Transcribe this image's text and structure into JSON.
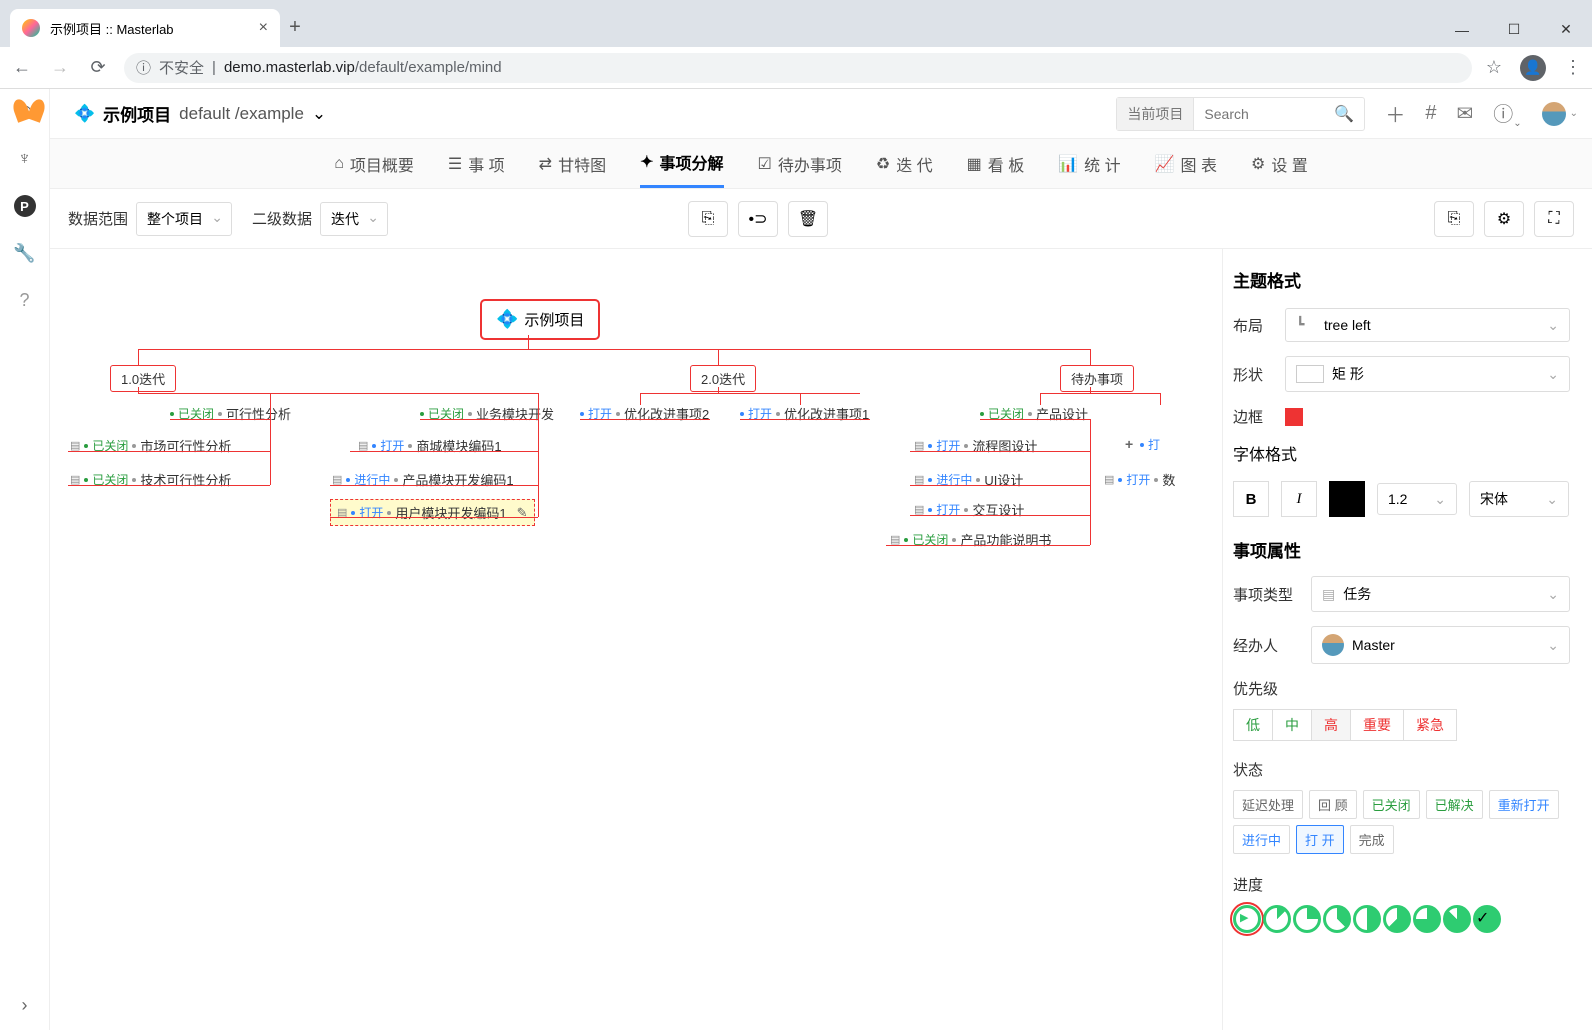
{
  "browser": {
    "tab_title": "示例项目 :: Masterlab",
    "url_insecure": "不安全",
    "url_host": "demo.masterlab.vip",
    "url_path": "/default/example/mind"
  },
  "header": {
    "project_name": "示例项目",
    "project_path": "default /example",
    "search_label": "当前项目",
    "search_placeholder": "Search"
  },
  "nav": {
    "overview": "项目概要",
    "issues": "事 项",
    "gantt": "甘特图",
    "breakdown": "事项分解",
    "backlog": "待办事项",
    "iteration": "迭 代",
    "kanban": "看 板",
    "stats": "统 计",
    "charts": "图 表",
    "settings": "设 置"
  },
  "toolbar": {
    "scope_label": "数据范围",
    "scope_value": "整个项目",
    "level2_label": "二级数据",
    "level2_value": "迭代"
  },
  "mind": {
    "root": "示例项目",
    "branch1": "1.0迭代",
    "branch2": "2.0迭代",
    "branch3": "待办事项",
    "status": {
      "closed": "已关闭",
      "open": "打开",
      "in_progress": "进行中"
    },
    "nodes": {
      "n1": "可行性分析",
      "n1a": "市场可行性分析",
      "n1b": "技术可行性分析",
      "n2": "业务模块开发",
      "n2a": "商城模块编码1",
      "n2b": "产品模块开发编码1",
      "n2c": "用户模块开发编码1",
      "n3": "优化改进事项2",
      "n4": "优化改进事项1",
      "n5": "产品设计",
      "n5a": "流程图设计",
      "n5b": "UI设计",
      "n5c": "交互设计",
      "n5d": "产品功能说明书",
      "n6": "打",
      "n7": "数"
    }
  },
  "panel": {
    "title_format": "主题格式",
    "layout_label": "布局",
    "layout_value": "tree left",
    "shape_label": "形状",
    "shape_value": "矩 形",
    "border_label": "边框",
    "font_format": "字体格式",
    "font_size": "1.2",
    "font_family": "宋体",
    "issue_props": "事项属性",
    "issue_type_label": "事项类型",
    "issue_type_value": "任务",
    "assignee_label": "经办人",
    "assignee_value": "Master",
    "priority_label": "优先级",
    "priority": {
      "low": "低",
      "med": "中",
      "high": "高",
      "important": "重要",
      "urgent": "紧急"
    },
    "status_label": "状态",
    "status": {
      "delayed": "延迟处理",
      "review": "回 顾",
      "closed": "已关闭",
      "solved": "已解决",
      "reopen": "重新打开",
      "in_progress": "进行中",
      "open": "打 开",
      "done": "完成"
    },
    "progress_label": "进度"
  }
}
